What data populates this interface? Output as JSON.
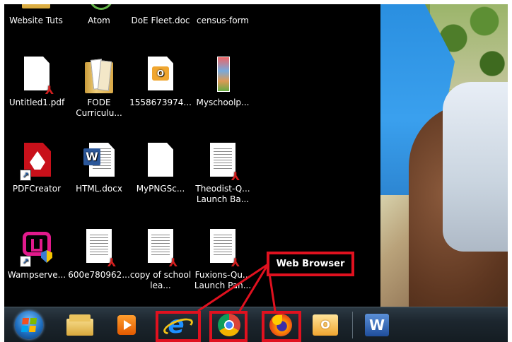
{
  "desktop": {
    "icons": [
      {
        "label": "Website Tuts",
        "icon": "folder-icon"
      },
      {
        "label": "Atom",
        "icon": "atom-icon"
      },
      {
        "label": "DoE Fleet.doc",
        "icon": "word-doc-icon"
      },
      {
        "label": "census-form",
        "icon": "document-icon"
      },
      {
        "label": "Untitled1.pdf",
        "icon": "pdf-icon"
      },
      {
        "label": "FODE Curriculu...",
        "icon": "folder-icon"
      },
      {
        "label": "1558673974...",
        "icon": "outlook-file-icon"
      },
      {
        "label": "Myschoolp...",
        "icon": "image-file-icon"
      },
      {
        "label": "PDFCreator",
        "icon": "pdfcreator-icon"
      },
      {
        "label": "HTML.docx",
        "icon": "word-doc-icon"
      },
      {
        "label": "MyPNGSc...",
        "icon": "blank-file-icon"
      },
      {
        "label": "Theodist-Q... Launch Ba...",
        "icon": "pdf-icon"
      },
      {
        "label": "Wampserve...",
        "icon": "wampserver-icon"
      },
      {
        "label": "600e780962...",
        "icon": "pdf-icon"
      },
      {
        "label": "copy of school lea...",
        "icon": "pdf-icon"
      },
      {
        "label": "Fuxions-Qu... Launch Pan...",
        "icon": "pdf-icon"
      }
    ]
  },
  "annotation": {
    "callout_text": "Web Browser",
    "highlight_color": "#e0111f"
  },
  "taskbar": {
    "items": [
      {
        "name": "start-button",
        "icon": "windows-start-icon"
      },
      {
        "name": "file-explorer",
        "icon": "folder-library-icon"
      },
      {
        "name": "media-player",
        "icon": "media-player-icon"
      },
      {
        "name": "internet-explorer",
        "icon": "internet-explorer-icon"
      },
      {
        "name": "chrome",
        "icon": "chrome-icon"
      },
      {
        "name": "firefox",
        "icon": "firefox-icon"
      },
      {
        "name": "outlook",
        "icon": "outlook-icon"
      },
      {
        "name": "word",
        "icon": "word-icon"
      }
    ]
  }
}
